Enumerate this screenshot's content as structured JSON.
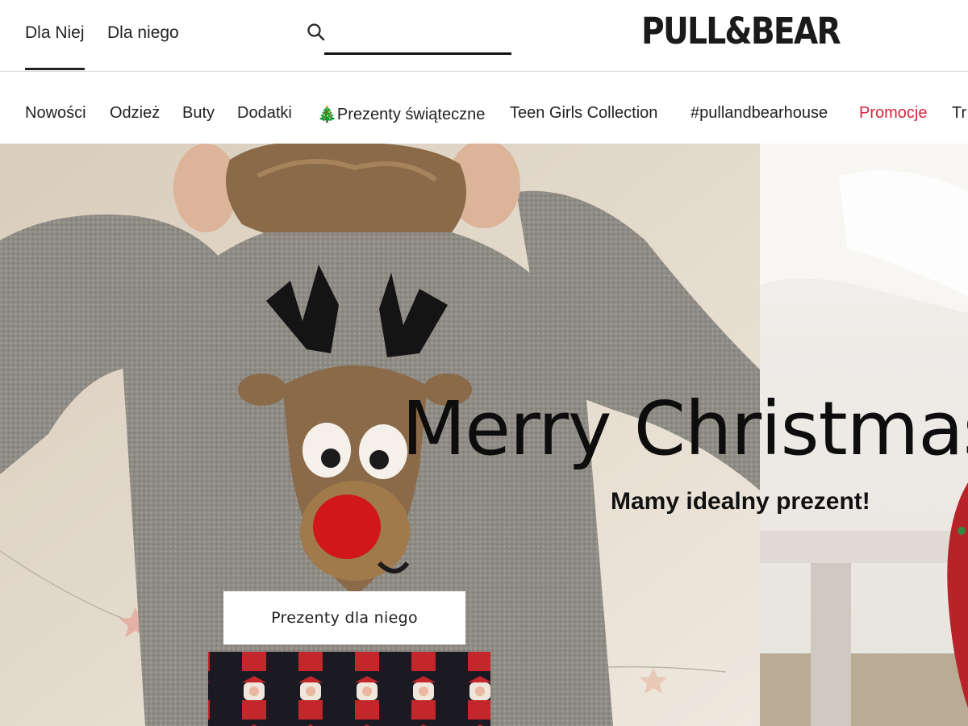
{
  "header": {
    "gender_tabs": [
      {
        "label": "Dla Niej",
        "active": true
      },
      {
        "label": "Dla niego",
        "active": false
      }
    ],
    "search": {
      "value": "",
      "placeholder": ""
    },
    "logo": "PULL&BEAR"
  },
  "nav": {
    "items": [
      {
        "label": "Nowości"
      },
      {
        "label": "Odzież"
      },
      {
        "label": "Buty"
      },
      {
        "label": "Dodatki"
      },
      {
        "label": "🎄Prezenty świąteczne"
      },
      {
        "label": "Teen Girls Collection"
      },
      {
        "label": "#pullandbearhouse"
      },
      {
        "label": "Promocje",
        "highlight": true
      },
      {
        "label": "Tr"
      }
    ],
    "promo_color": "#d3263c"
  },
  "hero": {
    "title": "Merry Christmas",
    "subtitle": "Mamy idealny prezent!",
    "cta_label": "Prezenty dla niego"
  }
}
